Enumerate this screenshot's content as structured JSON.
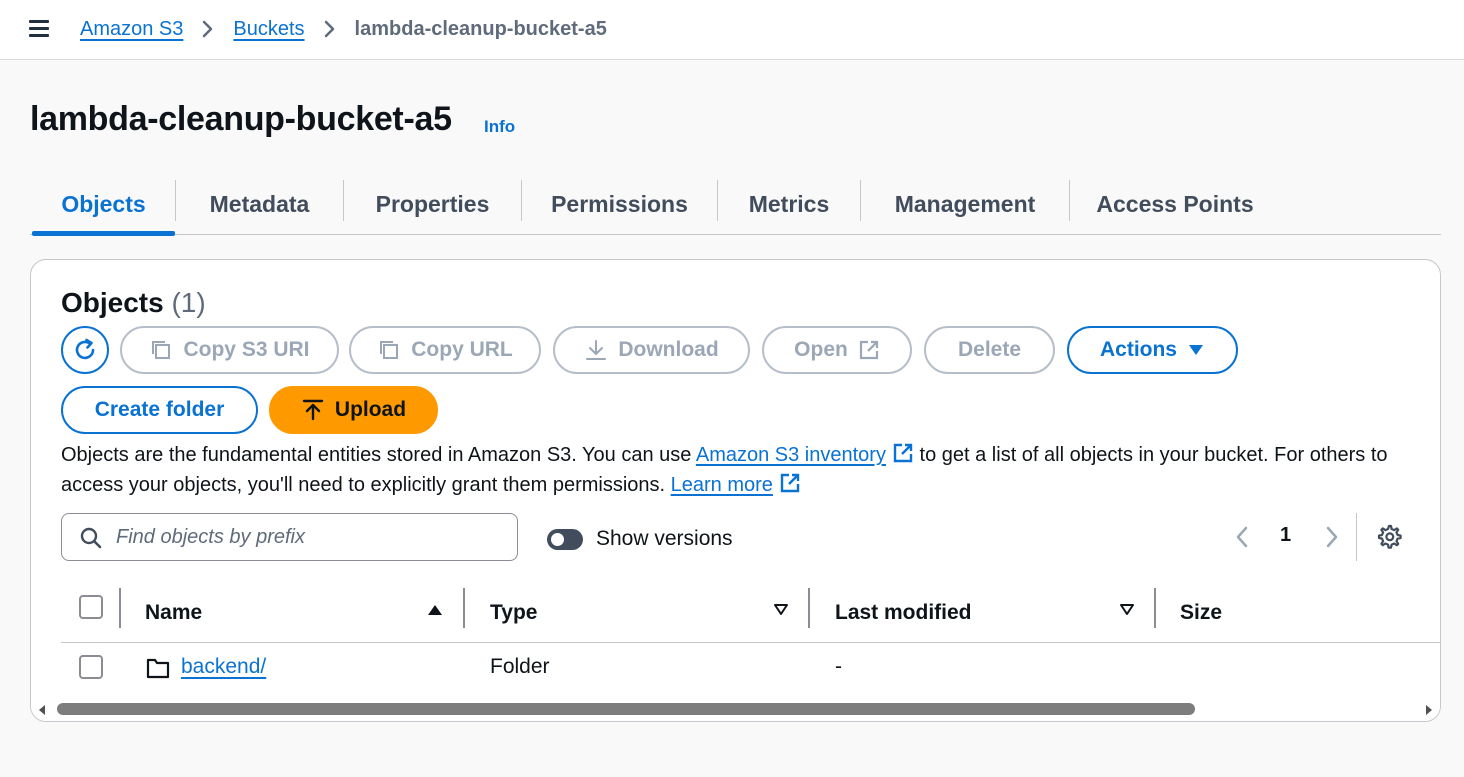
{
  "breadcrumb": {
    "items": [
      "Amazon S3",
      "Buckets"
    ],
    "current": "lambda-cleanup-bucket-a5"
  },
  "page": {
    "title": "lambda-cleanup-bucket-a5",
    "info_label": "Info"
  },
  "tabs": [
    {
      "label": "Objects",
      "active": true
    },
    {
      "label": "Metadata",
      "active": false
    },
    {
      "label": "Properties",
      "active": false
    },
    {
      "label": "Permissions",
      "active": false
    },
    {
      "label": "Metrics",
      "active": false
    },
    {
      "label": "Management",
      "active": false
    },
    {
      "label": "Access Points",
      "active": false
    }
  ],
  "objects_panel": {
    "title": "Objects",
    "count": "(1)",
    "buttons": {
      "refresh_icon": "refresh-icon",
      "copy_s3_uri": "Copy S3 URI",
      "copy_url": "Copy URL",
      "download": "Download",
      "open": "Open",
      "delete": "Delete",
      "actions": "Actions",
      "create_folder": "Create folder",
      "upload": "Upload"
    },
    "description": {
      "part1": "Objects are the fundamental entities stored in Amazon S3. You can use ",
      "inventory_link": "Amazon S3 inventory",
      "part2": " to get a list of all objects in your bucket. For others to access your objects, you'll need to explicitly grant them permissions. ",
      "learn_more_link": "Learn more"
    },
    "search": {
      "value": "",
      "placeholder": "Find objects by prefix"
    },
    "show_versions": {
      "label": "Show versions",
      "enabled": false
    },
    "pagination": {
      "current_page": "1"
    },
    "table": {
      "columns": [
        "Name",
        "Type",
        "Last modified",
        "Size"
      ],
      "rows": [
        {
          "name": "backend/",
          "type": "Folder",
          "last_modified": "-",
          "size": ""
        }
      ]
    }
  },
  "colors": {
    "accent": "#0972d3",
    "upload": "#ff9900",
    "disabled": "#9ba7b6"
  }
}
